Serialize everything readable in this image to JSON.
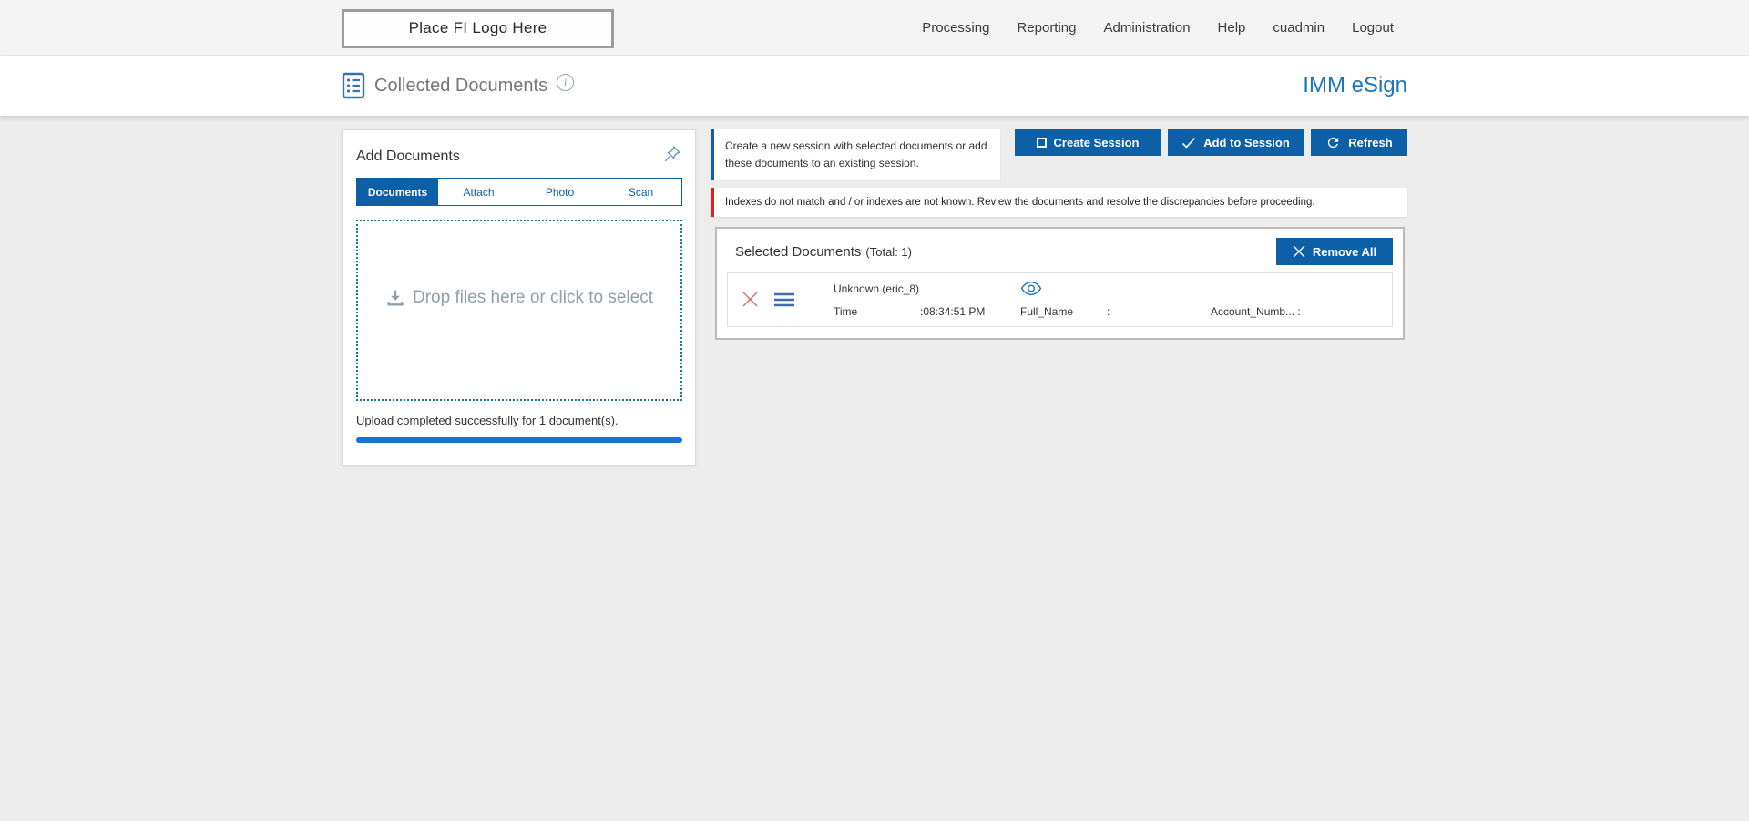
{
  "topbar": {
    "logo_text": "Place FI Logo Here",
    "nav": [
      {
        "label": "Processing"
      },
      {
        "label": "Reporting"
      },
      {
        "label": "Administration"
      },
      {
        "label": "Help"
      },
      {
        "label": "cuadmin"
      },
      {
        "label": "Logout"
      }
    ]
  },
  "header": {
    "title": "Collected Documents",
    "info_glyph": "i",
    "brand": "IMM eSign"
  },
  "add_documents": {
    "title": "Add Documents",
    "tabs": [
      {
        "label": "Documents",
        "active": true
      },
      {
        "label": "Attach",
        "active": false
      },
      {
        "label": "Photo",
        "active": false
      },
      {
        "label": "Scan",
        "active": false
      }
    ],
    "dropzone_text": "Drop files here or click to select",
    "upload_status": "Upload completed successfully for 1 document(s).",
    "progress_percent": 100
  },
  "session": {
    "info_message": "Create a new session with selected documents or add these documents to an existing session.",
    "warning_message": "Indexes do not match and / or indexes are not known. Review the documents and resolve the discrepancies before proceeding.",
    "buttons": {
      "create": "Create Session",
      "add": "Add to Session",
      "refresh": "Refresh"
    }
  },
  "selected_documents": {
    "title": "Selected Documents",
    "total_label": "(Total: 1)",
    "remove_all_label": "Remove All",
    "documents": [
      {
        "name": "Unknown (eric_8)",
        "fields": {
          "label1": "Time",
          "value1": ":08:34:51 PM",
          "label2": "Full_Name",
          "value2": ":",
          "label3": "Account_Numb... :"
        }
      }
    ]
  },
  "colors": {
    "primary_blue": "#0d5fa6",
    "brand_blue": "#1b75bb",
    "progress_blue": "#1973d3",
    "dropzone_teal": "#15768e",
    "warning_red": "#e02020",
    "remove_x_red": "#e26a6a",
    "drag_handle_blue": "#3f6fa8"
  }
}
